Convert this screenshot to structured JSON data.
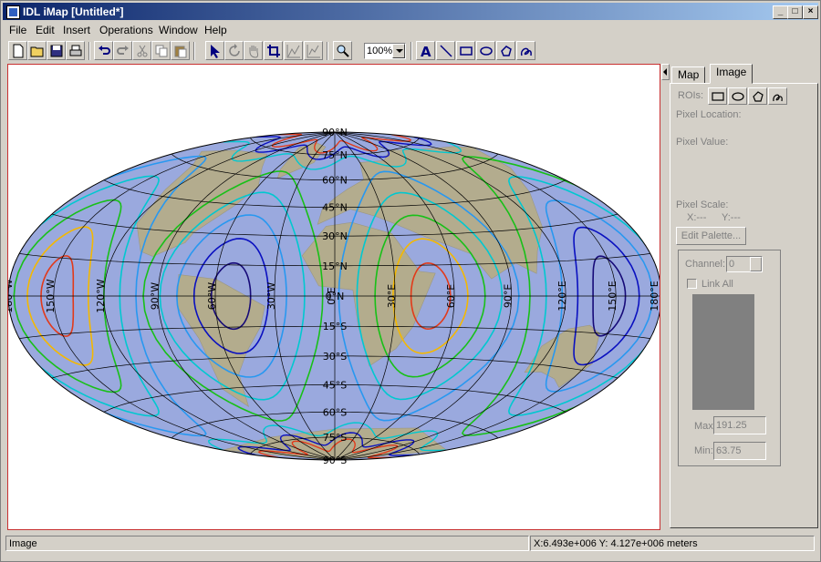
{
  "window": {
    "title": "IDL iMap [Untitled*]"
  },
  "menu": [
    "File",
    "Edit",
    "Insert",
    "Operations",
    "Window",
    "Help"
  ],
  "toolbar": {
    "zoom_value": "100%",
    "icons": [
      "new-file-icon",
      "open-folder-icon",
      "save-icon",
      "print-icon",
      "undo-icon",
      "redo-icon",
      "cut-icon",
      "copy-icon",
      "paste-icon",
      "select-arrow-icon",
      "rotate-icon",
      "pan-hand-icon",
      "crop-icon",
      "line-profile-icon",
      "surface-icon",
      "zoom-magnifier-icon",
      "text-icon",
      "line-icon",
      "rectangle-icon",
      "oval-icon",
      "polygon-icon",
      "freehand-icon"
    ]
  },
  "map": {
    "projection": "Hammer-Aitoff",
    "lat_labels": [
      "90°N",
      "75°N",
      "60°N",
      "45°N",
      "30°N",
      "15°N",
      "0°N",
      "15°S",
      "30°S",
      "45°S",
      "60°S",
      "75°S",
      "90°S"
    ],
    "lon_labels": [
      "180°W",
      "150°W",
      "120°W",
      "90°W",
      "60°W",
      "30°W",
      "0°E",
      "30°E",
      "60°E",
      "90°E",
      "120°E",
      "150°E",
      "180°E"
    ],
    "ocean_color": "#9aa9de",
    "contour_colors": [
      "#e23a1a",
      "#f4b800",
      "#18c018",
      "#00c8d0",
      "#2898f0",
      "#0a10c0",
      "#160a78"
    ]
  },
  "panel": {
    "tabs": [
      "Map",
      "Image"
    ],
    "active_tab": "Image",
    "rois_label": "ROIs:",
    "pixel_location_label": "Pixel Location:",
    "pixel_value_label": "Pixel Value:",
    "pixel_scale_label": "Pixel Scale:",
    "pixel_scale_x": "X:---",
    "pixel_scale_y": "Y:---",
    "edit_palette_label": "Edit Palette...",
    "channel_label": "Channel:",
    "channel_value": "0",
    "link_all_label": "Link All",
    "max_label": "Max:",
    "max_value": "191.25",
    "min_label": "Min:",
    "min_value": "63.75",
    "swatch_color": "#808080"
  },
  "status": {
    "left": "Image",
    "right": "X:6.493e+006  Y: 4.127e+006 meters"
  }
}
